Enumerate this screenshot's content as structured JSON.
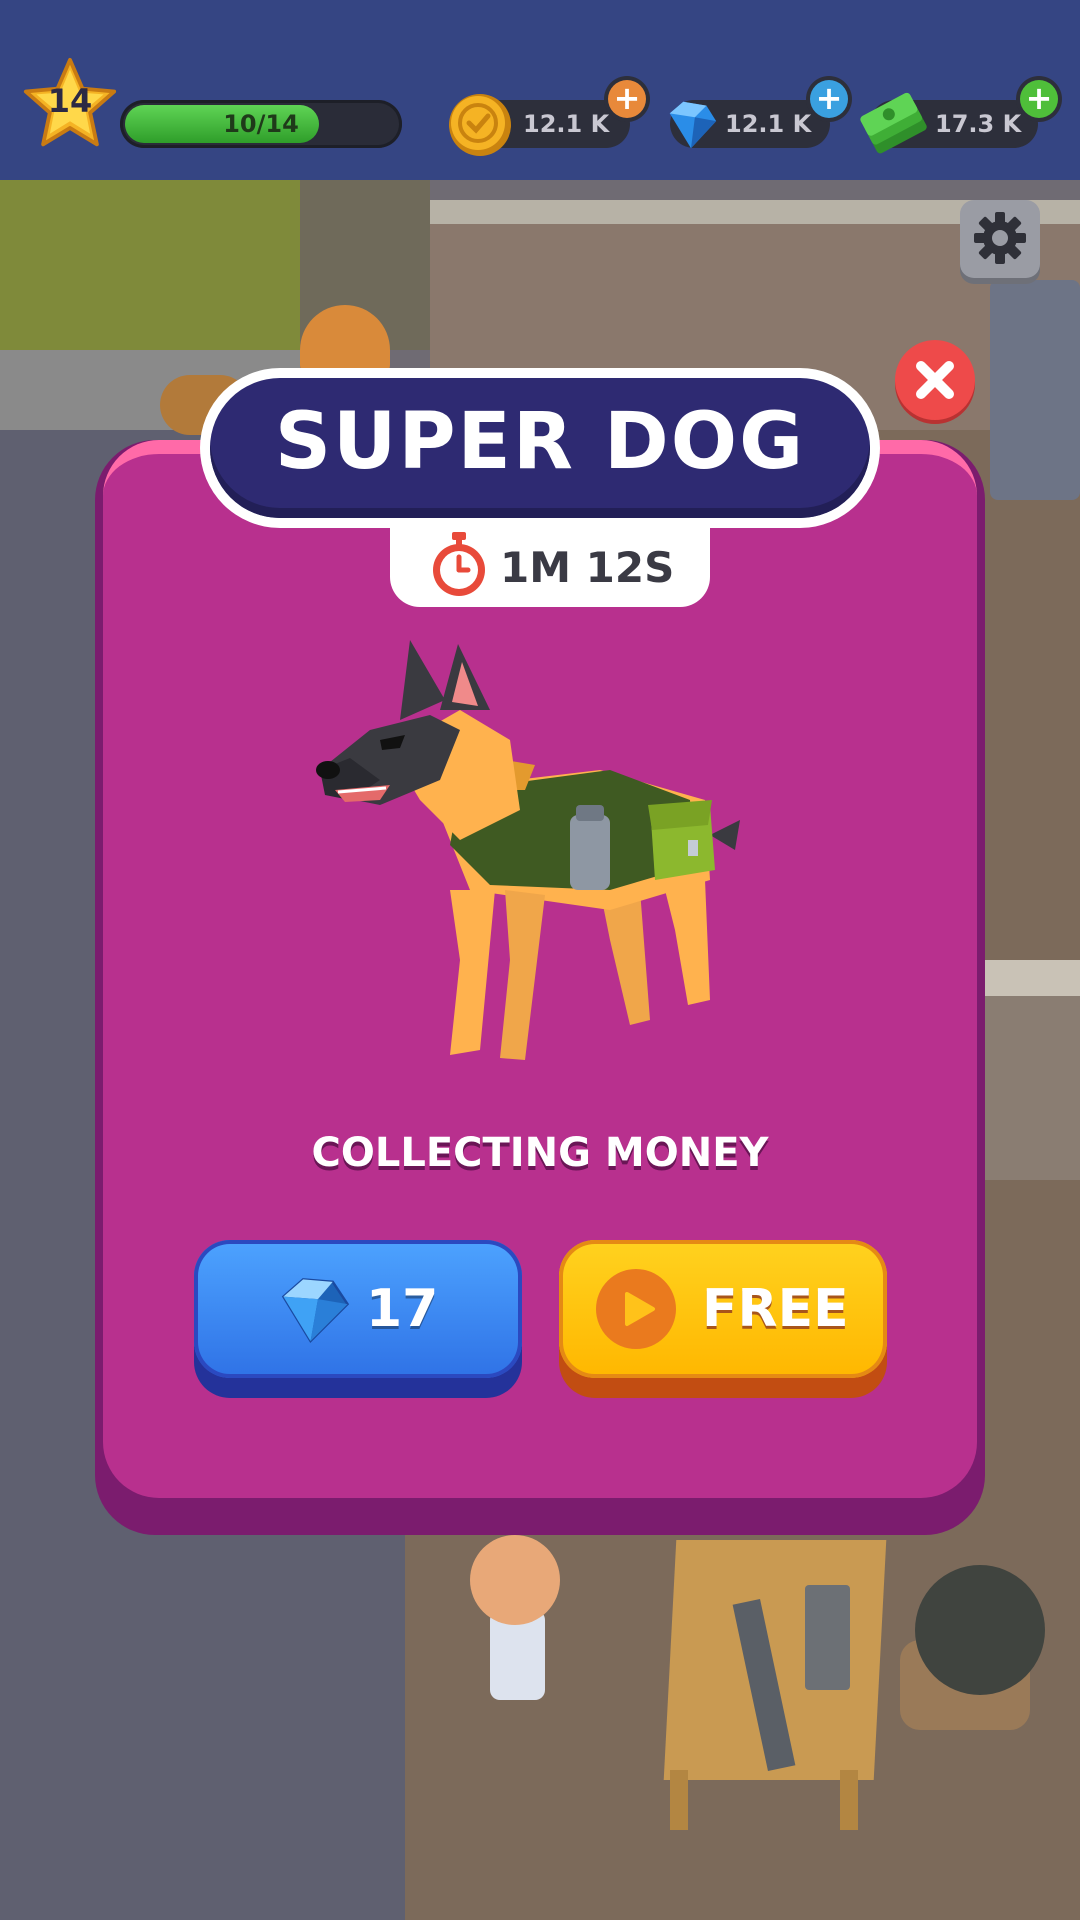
{
  "hud": {
    "level": "14",
    "xp_text": "10/14",
    "xp_progress": 0.714,
    "coins": "12.1 K",
    "gems": "12.1 K",
    "cash": "17.3 K"
  },
  "modal": {
    "title": "SUPER DOG",
    "timer": "1M 12S",
    "ability": "COLLECTING MONEY",
    "gems_price": "17",
    "free_label": "FREE"
  },
  "icons": {
    "level": "star-icon",
    "coins": "coin-icon",
    "gems": "gem-icon",
    "cash": "cash-icon",
    "settings": "gear-icon",
    "close": "close-icon",
    "timer": "stopwatch-icon",
    "video": "play-video-icon"
  },
  "colors": {
    "panel": "#b8308e",
    "title_bg": "#2e2a72",
    "close": "#ee4a4a",
    "gems_button": "#2f72e6",
    "free_button": "#ffb700"
  }
}
